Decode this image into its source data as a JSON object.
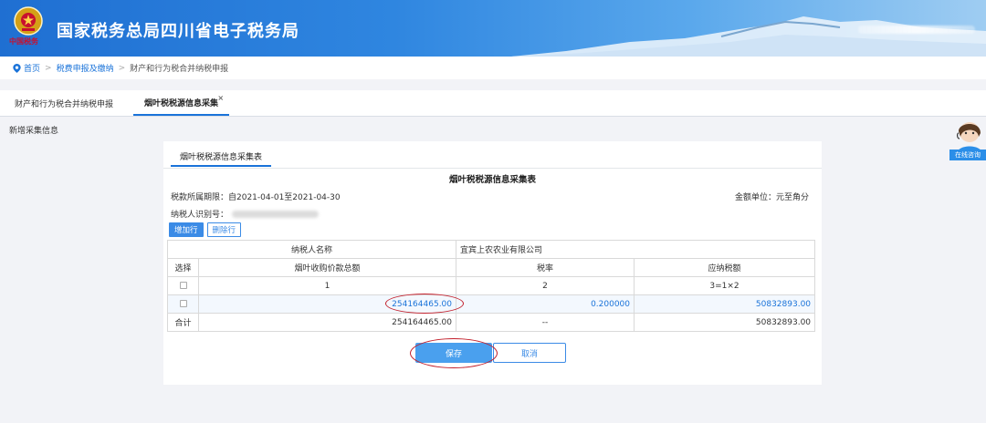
{
  "header": {
    "site_title": "国家税务总局四川省电子税务局",
    "emblem_caption": "中国税务"
  },
  "breadcrumb": {
    "home": "首页",
    "level1": "税费申报及缴纳",
    "level2": "财产和行为税合并纳税申报"
  },
  "tabs": [
    {
      "label": "财产和行为税合并纳税申报",
      "active": false
    },
    {
      "label": "烟叶税税源信息采集",
      "active": true,
      "closable": true
    }
  ],
  "tab_close_symbol": "×",
  "section_label": "新增采集信息",
  "panel": {
    "tab_label": "烟叶税税源信息采集表",
    "form_title": "烟叶税税源信息采集表",
    "period": "税款所属期限：自2021-04-01至2021-04-30",
    "unit": "金额单位：元至角分",
    "taxpayer_id_label": "纳税人识别号：",
    "buttons": {
      "add_row": "增加行",
      "delete_row": "删除行",
      "save": "保存",
      "cancel": "取消"
    },
    "table": {
      "taxpayer_name_label": "纳税人名称",
      "taxpayer_name_value": "宜宾上农农业有限公司",
      "headers": [
        "选择",
        "烟叶收购价款总额",
        "税率",
        "应纳税额"
      ],
      "index_row": [
        "1",
        "2",
        "3=1×2"
      ],
      "data_row": {
        "amount": "254164465.00",
        "rate": "0.200000",
        "tax": "50832893.00"
      },
      "total_row": {
        "label": "合计",
        "amount": "254164465.00",
        "rate": "--",
        "tax": "50832893.00"
      }
    }
  },
  "consult_widget": {
    "label": "在线咨询"
  },
  "colors": {
    "accent": "#1a73d9",
    "annotation": "#c21f2b",
    "save_button": "#4aa0ee"
  }
}
